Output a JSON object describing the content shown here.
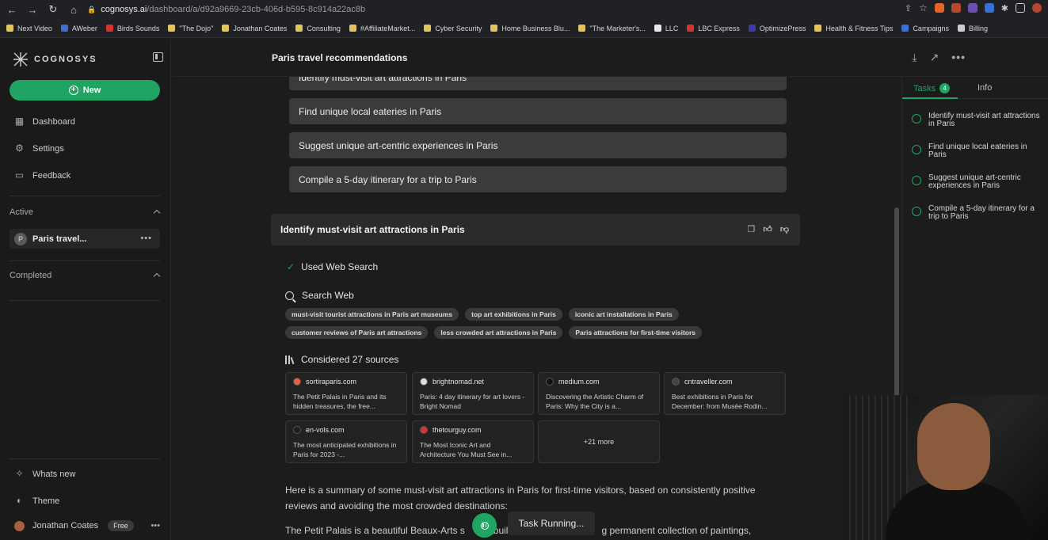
{
  "browser": {
    "url_domain": "cognosys.ai",
    "url_path": "/dashboard/a/d92a9669-23cb-406d-b595-8c914a22ac8b",
    "bookmarks": [
      "Next Video",
      "AWeber",
      "Birds Sounds",
      "\"The Dojo\"",
      "Jonathan Coates",
      "Consulting",
      "#AffiliateMarket...",
      "Cyber Security",
      "Home Business Blu...",
      "\"The Marketer's...",
      "LLC",
      "LBC Express",
      "OptimizePress",
      "Health & Fitness Tips",
      "Campaigns",
      "Billing"
    ]
  },
  "sidebar": {
    "logo_text": "COGNOSYS",
    "new_label": "New",
    "nav": [
      "Dashboard",
      "Settings",
      "Feedback"
    ],
    "active_title": "Active",
    "active_item_initial": "P",
    "active_item_label": "Paris travel...",
    "completed_title": "Completed",
    "whats_new": "Whats new",
    "theme": "Theme",
    "user_name": "Jonathan Coates",
    "plan_badge": "Free"
  },
  "header": {
    "title": "Paris travel recommendations"
  },
  "content": {
    "task_pills": [
      "Identify must-visit art attractions in Paris",
      "Find unique local eateries in Paris",
      "Suggest unique art-centric experiences in Paris",
      "Compile a 5-day itinerary for a trip to Paris"
    ],
    "section_title": "Identify must-visit art attractions in Paris",
    "used_web_search": "Used Web Search",
    "search_web": "Search Web",
    "queries_row1": [
      "must-visit tourist attractions in Paris art museums",
      "top art exhibitions in Paris",
      "iconic art installations in Paris"
    ],
    "queries_row2": [
      "customer reviews of Paris art attractions",
      "less crowded art attractions in Paris",
      "Paris attractions for first-time visitors"
    ],
    "considered_sources": "Considered 27 sources",
    "sources": [
      {
        "domain": "sortiraparis.com",
        "desc": "The Petit Palais in Paris and its hidden treasures, the free...",
        "color": "#e8613c"
      },
      {
        "domain": "brightnomad.net",
        "desc": "Paris: 4 day itinerary for art lovers - Bright Nomad",
        "color": "#dcdcdc"
      },
      {
        "domain": "medium.com",
        "desc": "Discovering the Artistic Charm of Paris: Why the City is a...",
        "color": "#111111"
      },
      {
        "domain": "cntraveller.com",
        "desc": "Best exhibitions in Paris for December: from Musée Rodin...",
        "color": "#444444"
      },
      {
        "domain": "en-vols.com",
        "desc": "The most anticipated exhibitions in Paris for 2023 -...",
        "color": "#1e1e1e"
      },
      {
        "domain": "thetourguy.com",
        "desc": "The Most Iconic Art and Architecture You Must See in...",
        "color": "#d8322f"
      }
    ],
    "more_sources": "+21 more",
    "summary": "Here is a summary of some must-visit art attractions in Paris for first-time visitors, based on consistently positive reviews and avoiding the most crowded destinations:",
    "summary_next_left": "The Petit Palais is a beautiful Beaux-Arts s",
    "summary_next_mid": "buil",
    "summary_next_right": "g permanent collection of paintings,",
    "task_running": "Task Running..."
  },
  "right_panel": {
    "tab_tasks": "Tasks",
    "tasks_count": "4",
    "tab_info": "Info",
    "tasks": [
      "Identify must-visit art attractions in Paris",
      "Find unique local eateries in Paris",
      "Suggest unique art-centric experiences in Paris",
      "Compile a 5-day itinerary for a trip to Paris"
    ]
  },
  "colors": {
    "accent": "#1fa463",
    "background": "#1c1c1c",
    "pill": "#3b3b3b"
  }
}
